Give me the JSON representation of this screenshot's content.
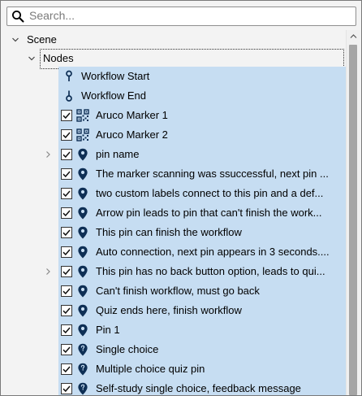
{
  "search": {
    "placeholder": "Search...",
    "value": ""
  },
  "tree": {
    "scene_label": "Scene",
    "nodes_label": "Nodes",
    "items": [
      {
        "label": "Workflow Start",
        "icon": "workflow-start-icon",
        "checkbox": false,
        "expander": false
      },
      {
        "label": "Workflow End",
        "icon": "workflow-end-icon",
        "checkbox": false,
        "expander": false
      },
      {
        "label": "Aruco Marker 1",
        "icon": "qr-marker-icon",
        "checkbox": true,
        "expander": false
      },
      {
        "label": "Aruco Marker 2",
        "icon": "qr-marker-icon",
        "checkbox": true,
        "expander": false
      },
      {
        "label": "pin name",
        "icon": "map-pin-icon",
        "checkbox": true,
        "expander": true
      },
      {
        "label": "The marker scanning was ssuccessful, next pin ...",
        "icon": "map-pin-icon",
        "checkbox": true,
        "expander": false
      },
      {
        "label": "two custom labels connect to this pin and a def...",
        "icon": "map-pin-icon",
        "checkbox": true,
        "expander": false
      },
      {
        "label": "Arrow pin leads to pin that can't finish the work...",
        "icon": "map-pin-icon",
        "checkbox": true,
        "expander": false
      },
      {
        "label": "This pin can finish the workflow",
        "icon": "map-pin-icon",
        "checkbox": true,
        "expander": false
      },
      {
        "label": "Auto connection, next pin appears in 3 seconds....",
        "icon": "map-pin-icon",
        "checkbox": true,
        "expander": false
      },
      {
        "label": "This pin has no back button option, leads to qui...",
        "icon": "map-pin-icon",
        "checkbox": true,
        "expander": true
      },
      {
        "label": "Can't finish  workflow, must go back",
        "icon": "map-pin-icon",
        "checkbox": true,
        "expander": false
      },
      {
        "label": "Quiz ends here, finish workflow",
        "icon": "map-pin-icon",
        "checkbox": true,
        "expander": false
      },
      {
        "label": "Pin 1",
        "icon": "map-pin-icon",
        "checkbox": true,
        "expander": false
      },
      {
        "label": "Single choice",
        "icon": "quiz-pin-icon",
        "checkbox": true,
        "expander": false
      },
      {
        "label": "Multiple choice quiz pin",
        "icon": "quiz-pin-icon",
        "checkbox": true,
        "expander": false
      },
      {
        "label": "Self-study single choice, feedback message",
        "icon": "quiz-pin-icon",
        "checkbox": true,
        "expander": false
      }
    ]
  },
  "colors": {
    "selection": "#c6ddf2",
    "icon_navy": "#0e2f55",
    "background": "#f3f3f3",
    "scroll_thumb": "#a5a5a5"
  }
}
